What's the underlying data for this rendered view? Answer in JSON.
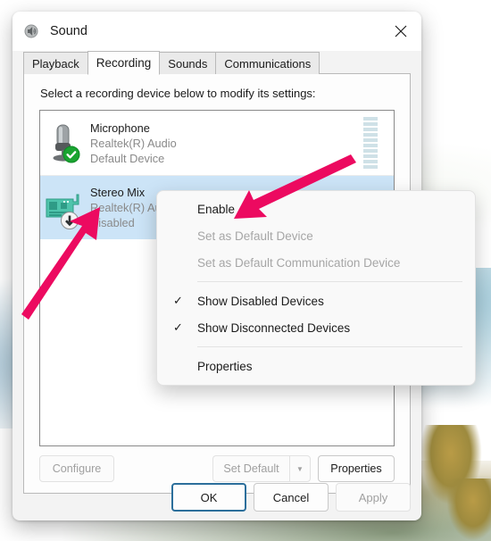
{
  "window": {
    "title": "Sound",
    "icon": "speaker-icon",
    "close_label": "✕"
  },
  "tabs": [
    {
      "label": "Playback",
      "active": false
    },
    {
      "label": "Recording",
      "active": true
    },
    {
      "label": "Sounds",
      "active": false
    },
    {
      "label": "Communications",
      "active": false
    }
  ],
  "panel": {
    "prompt": "Select a recording device below to modify its settings:"
  },
  "devices": [
    {
      "name": "Microphone",
      "driver": "Realtek(R) Audio",
      "status": "Default Device",
      "icon": "microphone-icon",
      "badge": "green-check-badge",
      "selected": false,
      "meter_segments": 10
    },
    {
      "name": "Stereo Mix",
      "driver": "Realtek(R) Audio",
      "status": "Disabled",
      "icon": "sound-card-icon",
      "badge": "down-arrow-badge",
      "selected": true,
      "meter_segments": 0
    }
  ],
  "panel_buttons": {
    "configure": {
      "label": "Configure",
      "enabled": false
    },
    "set_default": {
      "label": "Set Default",
      "enabled": false
    },
    "set_default_arrow": {
      "label": "▼",
      "enabled": false
    },
    "properties": {
      "label": "Properties",
      "enabled": true
    }
  },
  "footer_buttons": {
    "ok": {
      "label": "OK",
      "enabled": true,
      "focused": true
    },
    "cancel": {
      "label": "Cancel",
      "enabled": true,
      "focused": false
    },
    "apply": {
      "label": "Apply",
      "enabled": false,
      "focused": false
    }
  },
  "context_menu": {
    "items": [
      {
        "label": "Enable",
        "enabled": true,
        "checked": false
      },
      {
        "label": "Set as Default Device",
        "enabled": false,
        "checked": false
      },
      {
        "label": "Set as Default Communication Device",
        "enabled": false,
        "checked": false
      },
      {
        "separator_after": true
      },
      {
        "label": "Show Disabled Devices",
        "enabled": true,
        "checked": true
      },
      {
        "label": "Show Disconnected Devices",
        "enabled": true,
        "checked": true
      },
      {
        "separator_after": true
      },
      {
        "label": "Properties",
        "enabled": true,
        "checked": false
      }
    ],
    "check_glyph": "✓"
  },
  "annotations": {
    "arrow_color": "#ec0a60",
    "arrows": [
      {
        "name": "arrow-pointing-stereo-mix",
        "target": "Stereo Mix"
      },
      {
        "name": "arrow-pointing-enable",
        "target": "Enable"
      }
    ]
  },
  "colors": {
    "accent": "#2c6f9b",
    "selection": "#cce4f7",
    "meter": "#cfe1e7",
    "arrow": "#ec0a60"
  }
}
